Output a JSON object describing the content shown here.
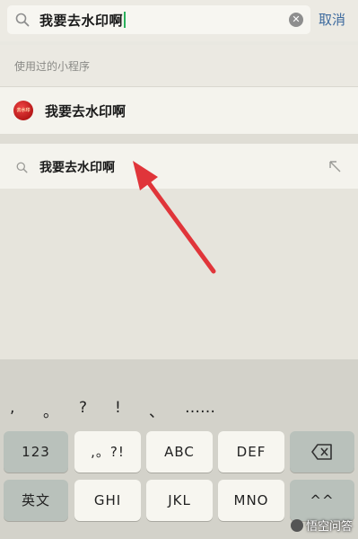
{
  "search": {
    "query": "我要去水印啊",
    "cancel_label": "取消"
  },
  "recent": {
    "section_title": "使用过的小程序",
    "mini_program_name": "我要去水印啊",
    "logo_text": "去水印"
  },
  "suggestion": {
    "text": "我要去水印啊"
  },
  "keyboard": {
    "punctuation": [
      ",",
      "。",
      "?",
      "!",
      "、",
      "……"
    ],
    "row1": [
      "123",
      ",。?!",
      "ABC",
      "DEF",
      "delete-icon"
    ],
    "row2": [
      "英文",
      "GHI",
      "JKL",
      "MNO",
      "^^"
    ]
  },
  "watermark": "悟空问答",
  "colors": {
    "arrow": "#e0353a",
    "caret": "#2bb05c",
    "cancel": "#3d6a9e"
  }
}
